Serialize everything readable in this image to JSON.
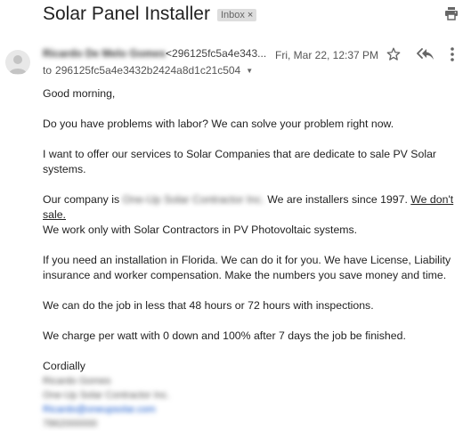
{
  "email": {
    "subject": "Solar Panel Installer",
    "label": "Inbox",
    "label_remove": "×",
    "sender_name": "Ricardo De Melo Gomes",
    "sender_email": "<296125fc5a4e343...",
    "date": "Fri, Mar 22, 12:37 PM",
    "to_prefix": "to",
    "to_address": "296125fc5a4e3432b2424a8d1c21c504",
    "body": {
      "greeting": "Good morning,",
      "p1": "Do you have problems with labor? We can solve your problem right now.",
      "p2": "I want to offer our services to Solar Companies that are dedicate to sale PV Solar systems.",
      "p3_before": "Our company is",
      "p3_company": "One-Up Solar Contractor Inc.",
      "p3_after": "We are installers since 1997.",
      "p3_underlined": "We don't sale.",
      "p3_line2": "We work only with Solar Contractors in PV Photovoltaic systems.",
      "p4": "If you need an installation in Florida. We can do it for you. We have License, Liability insurance and worker compensation. Make the numbers you save money and time.",
      "p5": "We can do the job in less that 48 hours or 72 hours with inspections.",
      "p6": "We charge per watt with 0 down and 100% after 7 days the job be finished.",
      "closing": "Cordially"
    },
    "signature": {
      "name": "Ricardo Gomes",
      "company": "One-Up Solar Contractor Inc.",
      "link": "Ricardo@oneupsolar.com",
      "phone": "7862000000"
    }
  },
  "icons": {
    "print": "print-icon",
    "star": "star-icon",
    "reply_all": "reply-all-icon",
    "more": "more-vertical-icon",
    "avatar": "person-icon",
    "caret": "caret-down-icon"
  }
}
